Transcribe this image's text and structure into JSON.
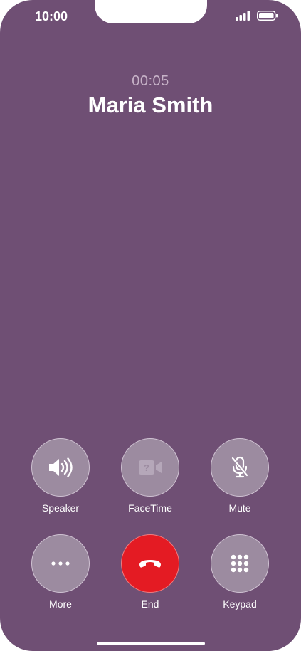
{
  "status_bar": {
    "time": "10:00",
    "signal_icon": "signal-bars-icon",
    "battery_icon": "battery-icon"
  },
  "call": {
    "duration": "00:05",
    "caller_name": "Maria Smith"
  },
  "controls": {
    "speaker": {
      "label": "Speaker",
      "icon": "speaker-icon"
    },
    "facetime": {
      "label": "FaceTime",
      "icon": "facetime-icon"
    },
    "mute": {
      "label": "Mute",
      "icon": "mute-icon"
    },
    "more": {
      "label": "More",
      "icon": "more-icon"
    },
    "end": {
      "label": "End",
      "icon": "end-call-icon"
    },
    "keypad": {
      "label": "Keypad",
      "icon": "keypad-icon"
    }
  },
  "colors": {
    "background": "#6f4f74",
    "button": "#9c8ba0",
    "end_button": "#e41b23",
    "timer_text": "#c7b3c8"
  }
}
